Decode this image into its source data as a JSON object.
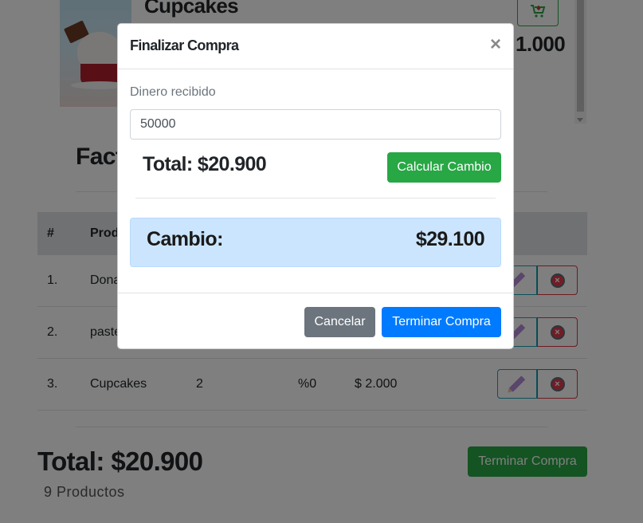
{
  "background": {
    "product": {
      "name": "Cupcakes",
      "price_partial": "1.000"
    },
    "invoice_title_partial": "Factu",
    "table": {
      "headers": {
        "num": "#",
        "product_partial": "Prod"
      },
      "rows": [
        {
          "num": "1.",
          "product": "Dona",
          "qty": "",
          "discount": "",
          "price": ""
        },
        {
          "num": "2.",
          "product": "paste",
          "qty": "",
          "discount": "",
          "price": ""
        },
        {
          "num": "3.",
          "product": "Cupcakes",
          "qty": "2",
          "discount": "%0",
          "price": "$ 2.000"
        }
      ]
    },
    "footer": {
      "total": "Total: $20.900",
      "count": "9 Productos",
      "button": "Terminar Compra"
    }
  },
  "modal": {
    "title": "Finalizar Compra",
    "close": "×",
    "received_label": "Dinero recibido",
    "received_value": "50000",
    "total": "Total: $20.900",
    "calc_button": "Calcular Cambio",
    "change_label": "Cambio:",
    "change_value": "$29.100",
    "cancel_button": "Cancelar",
    "finish_button": "Terminar Compra"
  },
  "colors": {
    "success": "#28a745",
    "primary": "#007bff",
    "secondary": "#6c757d",
    "info_bg": "#cce5ff",
    "danger": "#dc3545"
  }
}
